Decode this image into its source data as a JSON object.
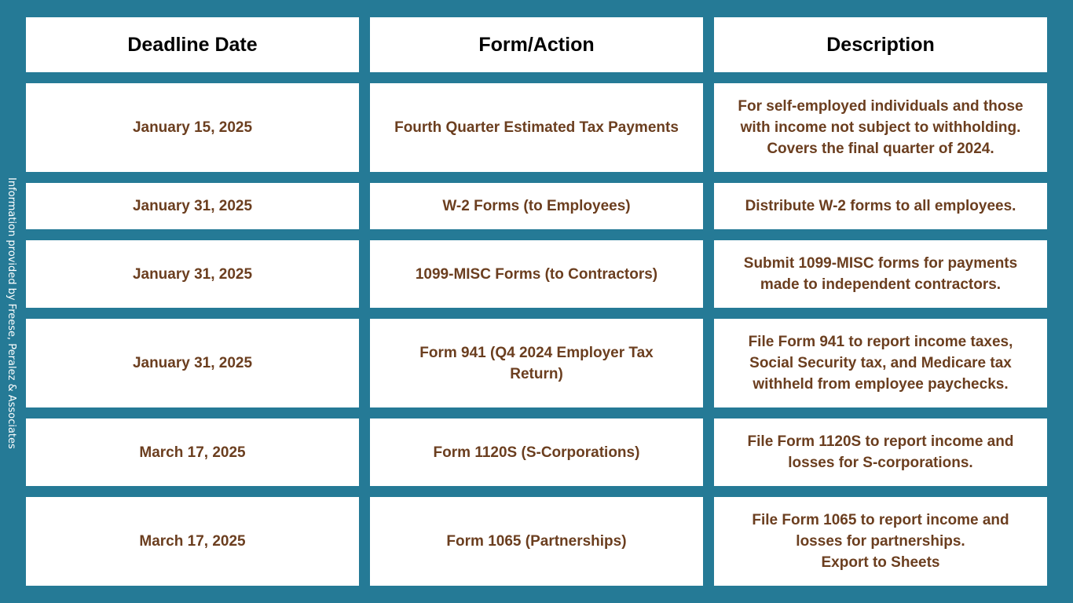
{
  "side_note": "Information provided by Freese, Peralez & Associates",
  "colors": {
    "background": "#257a96",
    "cell_background": "#ffffff",
    "header_text": "#000000",
    "body_text": "#6b3e1f"
  },
  "table": {
    "headers": [
      "Deadline Date",
      "Form/Action",
      "Description"
    ],
    "rows": [
      {
        "date": "January 15, 2025",
        "form": "Fourth Quarter Estimated Tax Payments",
        "description": "For self-employed individuals and those with income not subject to withholding. Covers the final quarter of 2024."
      },
      {
        "date": "January 31, 2025",
        "form": "W-2 Forms (to Employees)",
        "description": "Distribute W-2 forms to all employees."
      },
      {
        "date": "January 31, 2025",
        "form": "1099-MISC Forms (to Contractors)",
        "description": "Submit 1099-MISC forms for payments made to independent contractors."
      },
      {
        "date": "January 31, 2025",
        "form": "Form 941 (Q4 2024 Employer Tax Return)",
        "description": "File Form 941 to report income taxes, Social Security tax, and Medicare tax withheld from employee paychecks."
      },
      {
        "date": "March 17, 2025",
        "form": "Form 1120S (S-Corporations)",
        "description": "File Form 1120S to report income and losses for S-corporations."
      },
      {
        "date": "March 17, 2025",
        "form": "Form 1065 (Partnerships)",
        "description": "File Form 1065 to report income and losses for partnerships.",
        "extra_note": "Export to Sheets"
      }
    ]
  }
}
